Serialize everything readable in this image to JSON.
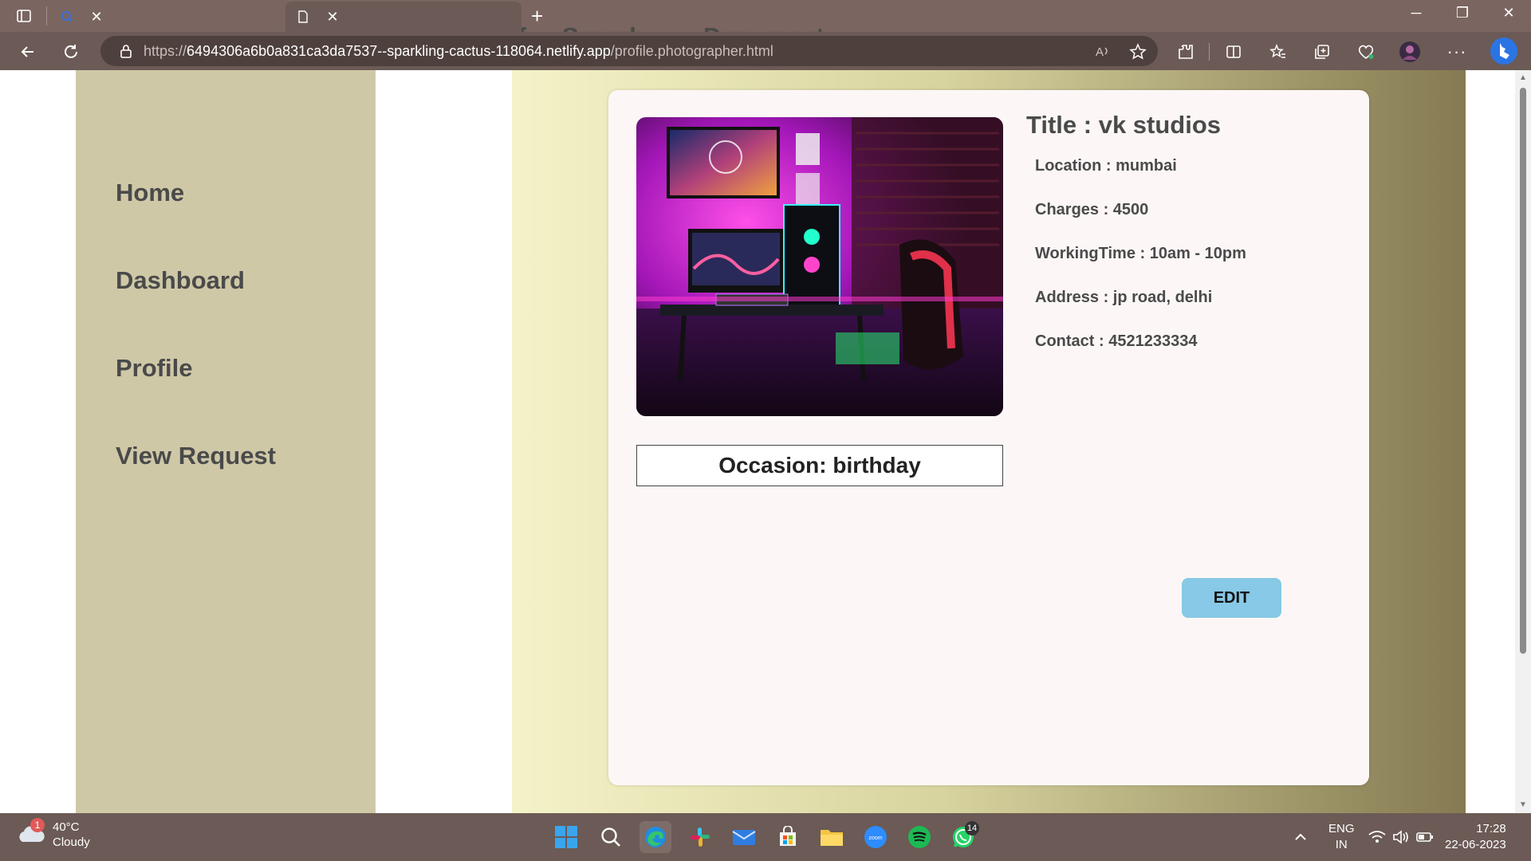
{
  "browser": {
    "tabs": [
      {
        "title": "netlify - Search",
        "icon": "bing-search-icon"
      },
      {
        "title": "Document",
        "icon": "document-icon"
      }
    ],
    "url": {
      "scheme": "https://",
      "host": "6494306a6b0a831ca3da7537--sparkling-cactus-118064.netlify.app",
      "path": "/profile.photographer.html"
    }
  },
  "sidebar": {
    "items": [
      {
        "label": "Home"
      },
      {
        "label": "Dashboard"
      },
      {
        "label": "Profile"
      },
      {
        "label": "View Request"
      }
    ]
  },
  "profile": {
    "title": "Title : vk studios",
    "occasion": "Occasion: birthday",
    "fields": [
      {
        "text": "Location : mumbai"
      },
      {
        "text": "Charges : 4500"
      },
      {
        "text": "WorkingTime : 10am - 10pm"
      },
      {
        "text": "Address : jp road, delhi"
      },
      {
        "text": "Contact : 4521233334"
      }
    ],
    "edit_label": "EDIT",
    "photo_alt": "gaming setup with neon lighting"
  },
  "taskbar": {
    "weather": {
      "temp": "40°C",
      "condition": "Cloudy",
      "badge": "1"
    },
    "whatsapp_badge": "14",
    "language": {
      "line1": "ENG",
      "line2": "IN"
    },
    "clock": {
      "time": "17:28",
      "date": "22-06-2023"
    }
  },
  "colors": {
    "sidebar": "#cfc8a7",
    "card": "#fcf7f6",
    "edit_button": "#87c9e6",
    "chrome": "#6b5a55"
  }
}
